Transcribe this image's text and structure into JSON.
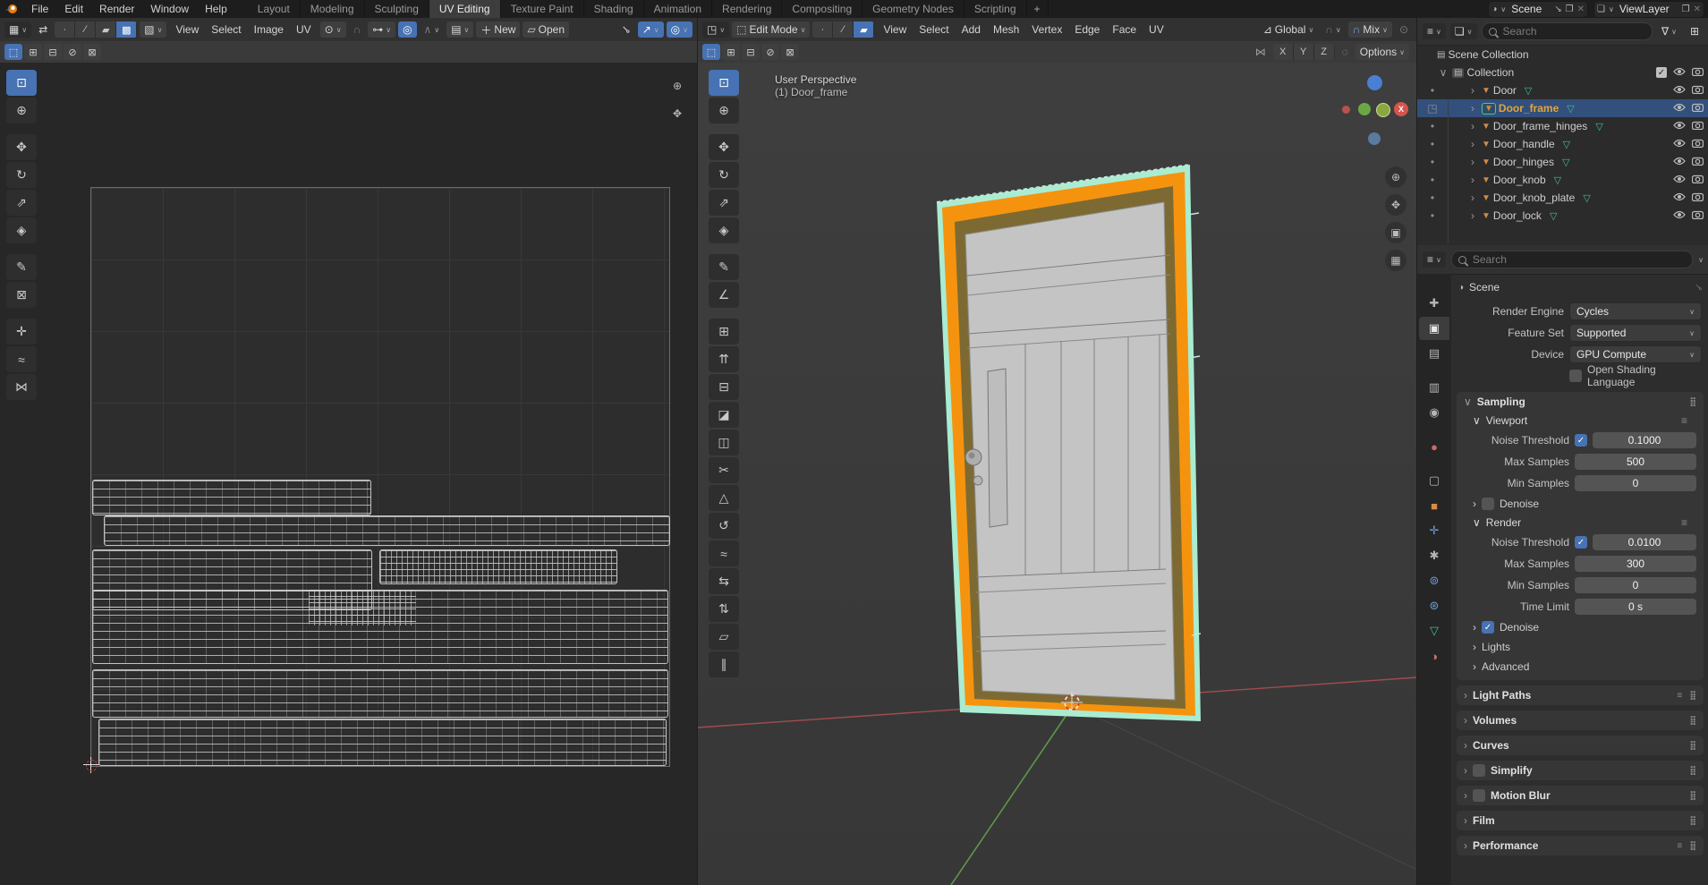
{
  "topbar": {
    "menus": [
      "File",
      "Edit",
      "Render",
      "Window",
      "Help"
    ],
    "workspace_tabs": [
      {
        "label": "Layout",
        "active": false
      },
      {
        "label": "Modeling",
        "active": false
      },
      {
        "label": "Sculpting",
        "active": false
      },
      {
        "label": "UV Editing",
        "active": true
      },
      {
        "label": "Texture Paint",
        "active": false
      },
      {
        "label": "Shading",
        "active": false
      },
      {
        "label": "Animation",
        "active": false
      },
      {
        "label": "Rendering",
        "active": false
      },
      {
        "label": "Compositing",
        "active": false
      },
      {
        "label": "Geometry Nodes",
        "active": false
      },
      {
        "label": "Scripting",
        "active": false
      }
    ],
    "add_tab_label": "+",
    "scene_selector": {
      "value": "Scene"
    },
    "view_layer_selector": {
      "value": "ViewLayer"
    }
  },
  "uv_editor": {
    "menus": [
      "View",
      "Select",
      "Image",
      "UV"
    ],
    "select_modes": [
      {
        "name": "uv-select-vertex",
        "glyph": "∙",
        "active": false
      },
      {
        "name": "uv-select-edge",
        "glyph": "∕",
        "active": false
      },
      {
        "name": "uv-select-face",
        "glyph": "▰",
        "active": false
      },
      {
        "name": "uv-select-island",
        "glyph": "▩",
        "active": true
      }
    ],
    "new_button_label": "New",
    "open_button_label": "Open",
    "snap_mode_label": "",
    "mode_icons": [
      {
        "name": "mode-set",
        "glyph": "⬚",
        "active": true
      },
      {
        "name": "mode-extend",
        "glyph": "⊞",
        "active": false
      },
      {
        "name": "mode-subtract",
        "glyph": "⊟",
        "active": false
      },
      {
        "name": "mode-invert",
        "glyph": "⊘",
        "active": false
      },
      {
        "name": "mode-intersect",
        "glyph": "⊠",
        "active": false
      }
    ],
    "tools": [
      {
        "name": "tweak-select-tool",
        "glyph": "⊡",
        "active": true,
        "gap": false
      },
      {
        "name": "cursor-tool",
        "glyph": "⊕",
        "active": false,
        "gap": false
      },
      {
        "name": "move-tool",
        "glyph": "✥",
        "active": false,
        "gap": true
      },
      {
        "name": "rotate-tool",
        "glyph": "↻",
        "active": false,
        "gap": false
      },
      {
        "name": "scale-tool",
        "glyph": "⇗",
        "active": false,
        "gap": false
      },
      {
        "name": "transform-tool",
        "glyph": "◈",
        "active": false,
        "gap": false
      },
      {
        "name": "annotate-tool",
        "glyph": "✎",
        "active": false,
        "gap": true
      },
      {
        "name": "rip-region-tool",
        "glyph": "⊠",
        "active": false,
        "gap": false
      },
      {
        "name": "grab-tool",
        "glyph": "✛",
        "active": false,
        "gap": true
      },
      {
        "name": "relax-tool",
        "glyph": "≈",
        "active": false,
        "gap": false
      },
      {
        "name": "pinch-tool",
        "glyph": "⋈",
        "active": false,
        "gap": false
      }
    ]
  },
  "viewport_3d": {
    "mode_label": "Edit Mode",
    "menus": [
      "View",
      "Select",
      "Add",
      "Mesh",
      "Vertex",
      "Edge",
      "Face",
      "UV"
    ],
    "select_modes": [
      {
        "name": "select-mode-vertex",
        "glyph": "∙",
        "active": false
      },
      {
        "name": "select-mode-edge",
        "glyph": "∕",
        "active": false
      },
      {
        "name": "select-mode-face",
        "glyph": "▰",
        "active": true
      }
    ],
    "orientation_label": "Global",
    "snap_mode_label": "Mix",
    "mirror_axes": [
      "X",
      "Y",
      "Z"
    ],
    "options_label": "Options",
    "overlay": {
      "view_label": "User Perspective",
      "object_label": "(1) Door_frame"
    },
    "gizmo_x_label": "X",
    "mode_icons": [
      {
        "name": "mode-set",
        "glyph": "⬚",
        "active": true
      },
      {
        "name": "mode-extend",
        "glyph": "⊞",
        "active": false
      },
      {
        "name": "mode-subtract",
        "glyph": "⊟",
        "active": false
      },
      {
        "name": "mode-invert",
        "glyph": "⊘",
        "active": false
      },
      {
        "name": "mode-intersect",
        "glyph": "⊠",
        "active": false
      }
    ],
    "tools": [
      {
        "name": "select-box-tool",
        "glyph": "⊡",
        "active": true,
        "gap": false
      },
      {
        "name": "cursor-tool",
        "glyph": "⊕",
        "active": false,
        "gap": false
      },
      {
        "name": "move-tool",
        "glyph": "✥",
        "active": false,
        "gap": true
      },
      {
        "name": "rotate-tool",
        "glyph": "↻",
        "active": false,
        "gap": false
      },
      {
        "name": "scale-tool",
        "glyph": "⇗",
        "active": false,
        "gap": false
      },
      {
        "name": "transform-tool",
        "glyph": "◈",
        "active": false,
        "gap": false
      },
      {
        "name": "annotate-tool",
        "glyph": "✎",
        "active": false,
        "gap": true
      },
      {
        "name": "measure-tool",
        "glyph": "∠",
        "active": false,
        "gap": false
      },
      {
        "name": "add-cube-tool",
        "glyph": "⊞",
        "active": false,
        "gap": true
      },
      {
        "name": "extrude-region-tool",
        "glyph": "⇈",
        "active": false,
        "gap": false
      },
      {
        "name": "inset-faces-tool",
        "glyph": "⊟",
        "active": false,
        "gap": false
      },
      {
        "name": "bevel-tool",
        "glyph": "◪",
        "active": false,
        "gap": false
      },
      {
        "name": "loop-cut-tool",
        "glyph": "◫",
        "active": false,
        "gap": false
      },
      {
        "name": "knife-tool",
        "glyph": "✂",
        "active": false,
        "gap": false
      },
      {
        "name": "poly-build-tool",
        "glyph": "△",
        "active": false,
        "gap": false
      },
      {
        "name": "spin-tool",
        "glyph": "↺",
        "active": false,
        "gap": false
      },
      {
        "name": "smooth-tool",
        "glyph": "≈",
        "active": false,
        "gap": false
      },
      {
        "name": "edge-slide-tool",
        "glyph": "⇆",
        "active": false,
        "gap": false
      },
      {
        "name": "shrink-fatten-tool",
        "glyph": "⇅",
        "active": false,
        "gap": false
      },
      {
        "name": "shear-tool",
        "glyph": "▱",
        "active": false,
        "gap": false
      },
      {
        "name": "rip-region-tool",
        "glyph": "∥",
        "active": false,
        "gap": false
      }
    ]
  },
  "outliner": {
    "search_placeholder": "Search",
    "scene_collection_label": "Scene Collection",
    "collection_label": "Collection",
    "objects": [
      {
        "name": "Door",
        "selected": false
      },
      {
        "name": "Door_frame",
        "selected": true
      },
      {
        "name": "Door_frame_hinges",
        "selected": false
      },
      {
        "name": "Door_handle",
        "selected": false
      },
      {
        "name": "Door_hinges",
        "selected": false
      },
      {
        "name": "Door_knob",
        "selected": false
      },
      {
        "name": "Door_knob_plate",
        "selected": false
      },
      {
        "name": "Door_lock",
        "selected": false
      }
    ]
  },
  "properties": {
    "search_placeholder": "Search",
    "breadcrumb": "Scene",
    "engine_fields": [
      {
        "label": "Render Engine",
        "value": "Cycles"
      },
      {
        "label": "Feature Set",
        "value": "Supported"
      },
      {
        "label": "Device",
        "value": "GPU Compute"
      }
    ],
    "osl": {
      "label": "Open Shading Language",
      "checked": false
    },
    "sampling": {
      "title": "Sampling",
      "viewport": {
        "title": "Viewport",
        "rows": [
          {
            "label": "Noise Threshold",
            "value": "0.1000",
            "checkbox": true,
            "checked": true
          },
          {
            "label": "Max Samples",
            "value": "500",
            "checkbox": false,
            "checked": false
          },
          {
            "label": "Min Samples",
            "value": "0",
            "checkbox": false,
            "checked": false
          }
        ],
        "denoise": {
          "label": "Denoise",
          "checked": false
        }
      },
      "render": {
        "title": "Render",
        "rows": [
          {
            "label": "Noise Threshold",
            "value": "0.0100",
            "checkbox": true,
            "checked": true
          },
          {
            "label": "Max Samples",
            "value": "300",
            "checkbox": false,
            "checked": false
          },
          {
            "label": "Min Samples",
            "value": "0",
            "checkbox": false,
            "checked": false
          },
          {
            "label": "Time Limit",
            "value": "0 s",
            "checkbox": false,
            "checked": false
          }
        ],
        "denoise": {
          "label": "Denoise",
          "checked": true
        }
      },
      "collapsed": [
        {
          "label": "Lights"
        },
        {
          "label": "Advanced"
        }
      ]
    },
    "panels": [
      {
        "label": "Light Paths",
        "preset": true,
        "checkbox": false
      },
      {
        "label": "Volumes",
        "preset": false,
        "checkbox": false
      },
      {
        "label": "Curves",
        "preset": false,
        "checkbox": false
      },
      {
        "label": "Simplify",
        "preset": false,
        "checkbox": true
      },
      {
        "label": "Motion Blur",
        "preset": false,
        "checkbox": true
      },
      {
        "label": "Film",
        "preset": false,
        "checkbox": false
      },
      {
        "label": "Performance",
        "preset": true,
        "checkbox": false
      }
    ],
    "tabs": [
      {
        "name": "tool",
        "glyph": "✚",
        "color": "#b5b5b5",
        "active": false,
        "gap": true
      },
      {
        "name": "render",
        "glyph": "▣",
        "color": "#e8e8e8",
        "active": true,
        "gap": false
      },
      {
        "name": "output",
        "glyph": "▤",
        "color": "#b5b5b5",
        "active": false,
        "gap": false
      },
      {
        "name": "view-layer",
        "glyph": "▥",
        "color": "#b5b5b5",
        "active": false,
        "gap": true
      },
      {
        "name": "scene",
        "glyph": "◉",
        "color": "#b5b5b5",
        "active": false,
        "gap": false
      },
      {
        "name": "world",
        "glyph": "●",
        "color": "#cc6b6b",
        "active": false,
        "gap": true
      },
      {
        "name": "collection",
        "glyph": "▢",
        "color": "#b5b5b5",
        "active": false,
        "gap": true
      },
      {
        "name": "object",
        "glyph": "■",
        "color": "#d98c3f",
        "active": false,
        "gap": false
      },
      {
        "name": "modifiers",
        "glyph": "✛",
        "color": "#6a9fd8",
        "active": false,
        "gap": false
      },
      {
        "name": "particles",
        "glyph": "✱",
        "color": "#b5b5b5",
        "active": false,
        "gap": false
      },
      {
        "name": "physics",
        "glyph": "⊚",
        "color": "#6a9fd8",
        "active": false,
        "gap": false
      },
      {
        "name": "constraints",
        "glyph": "⊛",
        "color": "#6a9fd8",
        "active": false,
        "gap": false
      },
      {
        "name": "object-data",
        "glyph": "▽",
        "color": "#3fbf8f",
        "active": false,
        "gap": false
      },
      {
        "name": "material",
        "glyph": "◑",
        "color": "#c77777",
        "active": false,
        "gap": false
      }
    ]
  },
  "colors": {
    "accent_blue": "#4772b3",
    "selection_orange": "#f5930f",
    "frame_inner": "#7d6a33",
    "outline_mint": "#a9ecd2",
    "mesh_icon_orange": "#cf8a4a",
    "data_icon_green": "#3fbf8f",
    "selected_row_blue": "#33507c",
    "active_name_orange": "#e2a43b",
    "axis_red": "#b04a4a",
    "axis_green": "#6aa84f"
  }
}
